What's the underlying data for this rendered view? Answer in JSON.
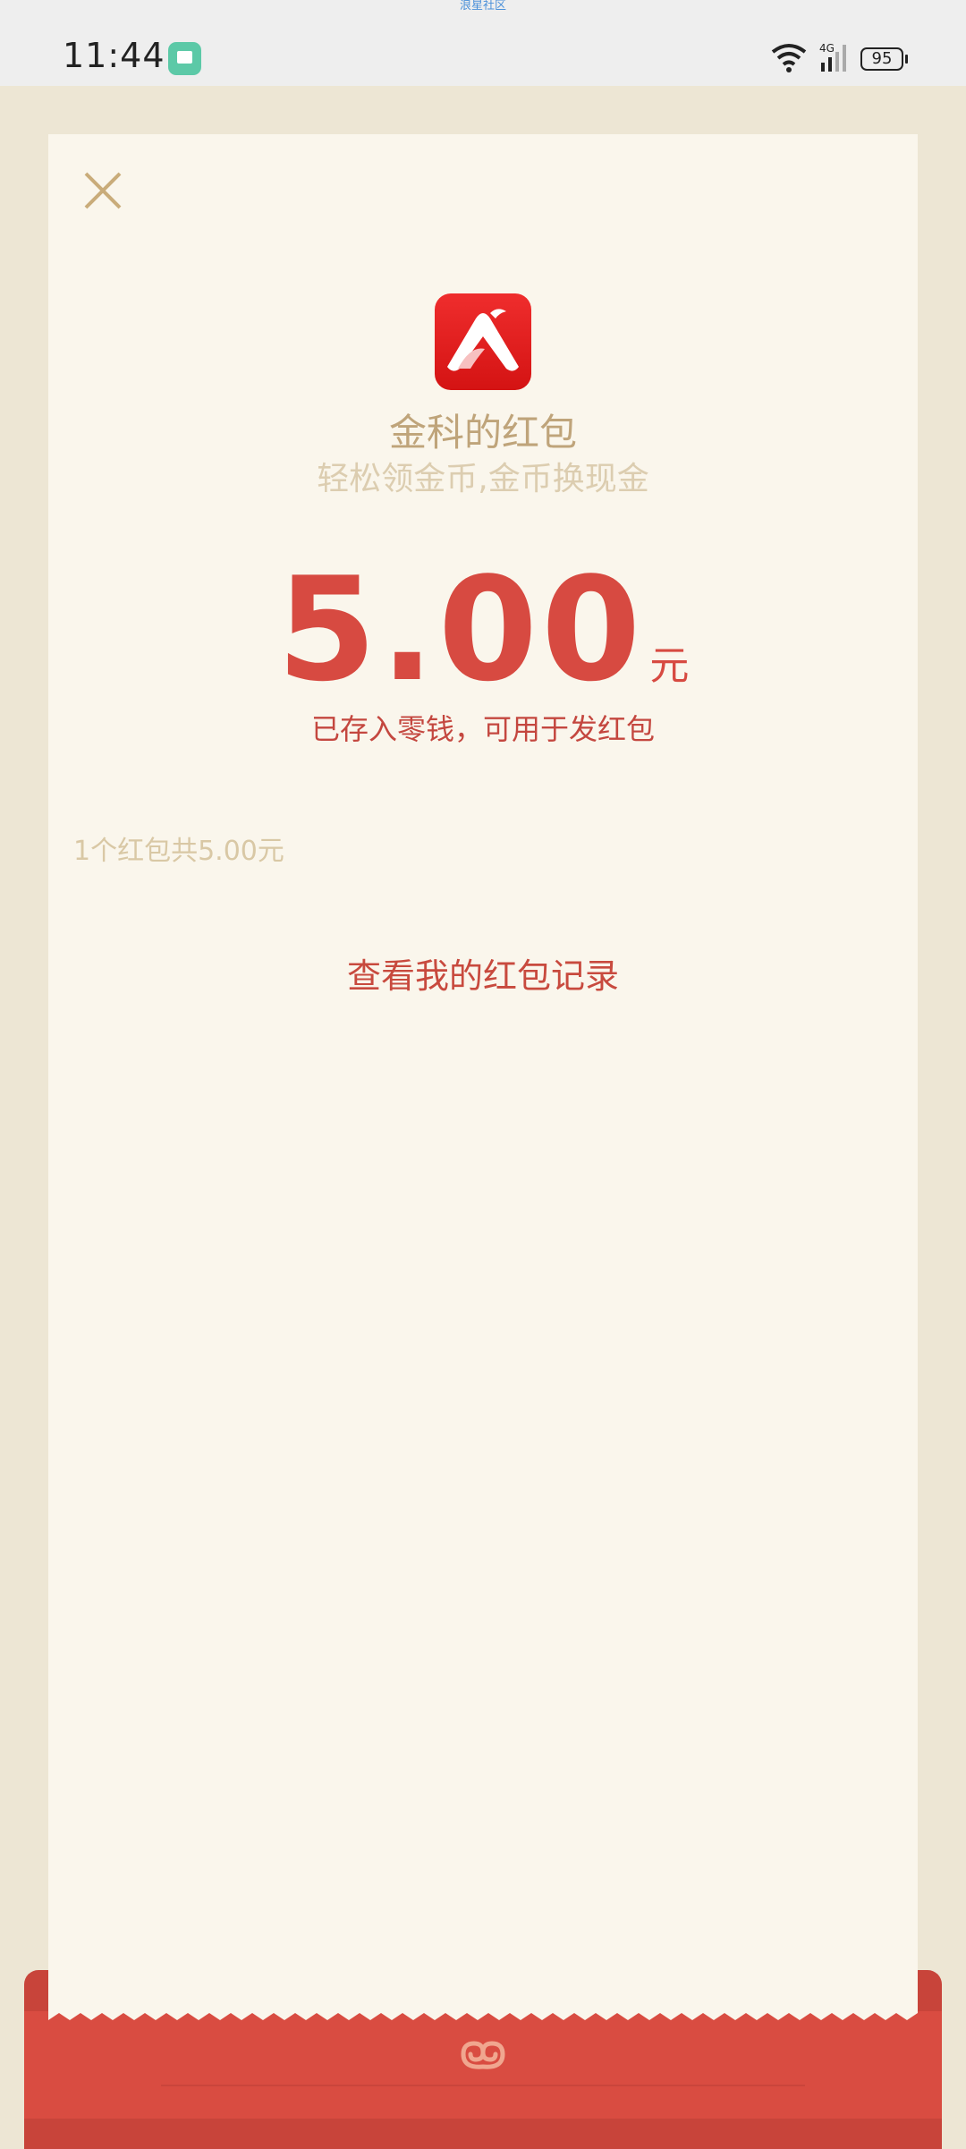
{
  "status_bar": {
    "caption": "浪星社区",
    "time": "11:44",
    "battery_level": "95",
    "network": "4G"
  },
  "red_packet": {
    "sender_title": "金科的红包",
    "subtitle": "轻松领金币,金币换现金",
    "amount": "5.00",
    "currency_unit": "元",
    "stored_note": "已存入零钱，可用于发红包",
    "summary": "1个红包共5.00元",
    "records_link": "查看我的红包记录"
  },
  "colors": {
    "accent_red": "#d74a41",
    "gold": "#bfa47a",
    "card_bg": "#faf6ec"
  },
  "icons": [
    "close-icon",
    "app-logo-icon",
    "wifi-icon",
    "signal-icon",
    "message-app-icon",
    "cloud-emblem-icon"
  ]
}
